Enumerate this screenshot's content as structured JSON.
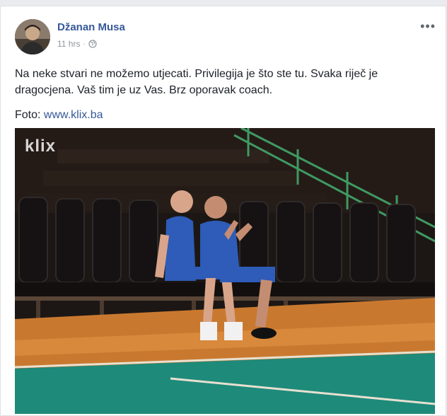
{
  "post": {
    "author_name": "Džanan Musa",
    "timestamp": "11 hrs",
    "separator": "·",
    "privacy_icon": "globe-icon",
    "more_label": "•••",
    "text": "Na neke stvari ne možemo utjecati. Privilegija je što ste tu. Svaka riječ je dragocjena. Vaš tim je uz Vas. Brz oporavak coach.",
    "photo_credit_prefix": "Foto: ",
    "photo_credit_link": "www.klix.ba",
    "photo_watermark": "klix"
  },
  "colors": {
    "author": "#365899",
    "link": "#365899",
    "meta": "#90949c",
    "text": "#1d2129",
    "court_floor": "#c9792f",
    "court_green": "#1e8a7a",
    "shirt_blue": "#2e5cb8"
  }
}
